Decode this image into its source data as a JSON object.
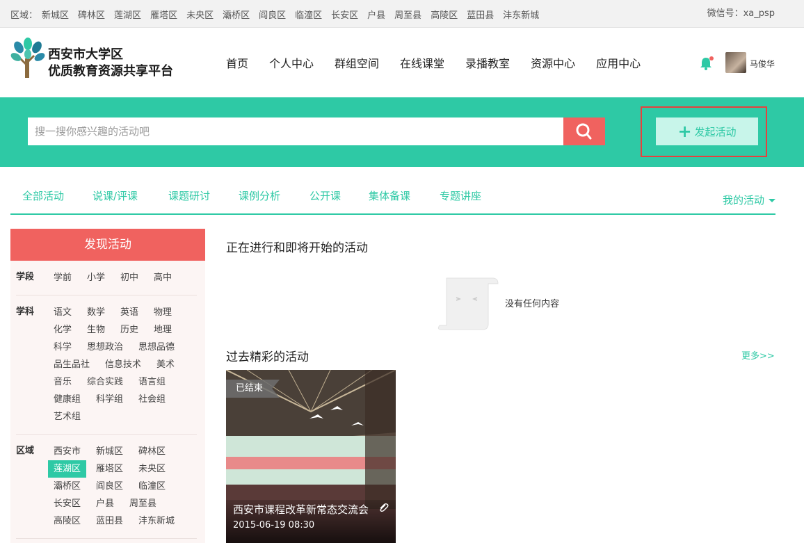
{
  "topbar": {
    "region_label": "区域：",
    "regions": [
      "新城区",
      "碑林区",
      "莲湖区",
      "雁塔区",
      "未央区",
      "灞桥区",
      "阎良区",
      "临潼区",
      "长安区",
      "户县",
      "周至县",
      "高陵区",
      "蓝田县",
      "沣东新城"
    ],
    "wechat": "微信号：xa_psp"
  },
  "logo": {
    "line1": "西安市大学区",
    "line2": "优质教育资源共享平台"
  },
  "nav": [
    "首页",
    "个人中心",
    "群组空间",
    "在线课堂",
    "录播教室",
    "资源中心",
    "应用中心"
  ],
  "user": {
    "name": "马俊华"
  },
  "search": {
    "placeholder": "搜一搜你感兴趣的活动吧",
    "launch_label": "发起活动"
  },
  "tabs": [
    "全部活动",
    "说课/评课",
    "课题研讨",
    "课例分析",
    "公开课",
    "集体备课",
    "专题讲座"
  ],
  "my_activities": "我的活动",
  "sidebar": {
    "title": "发现活动",
    "groups": [
      {
        "label": "学段",
        "items": [
          "学前",
          "小学",
          "初中",
          "高中"
        ]
      },
      {
        "label": "学科",
        "items": [
          "语文",
          "数学",
          "英语",
          "物理",
          "化学",
          "生物",
          "历史",
          "地理",
          "科学",
          "思想政治",
          "思想品德",
          "品生品社",
          "信息技术",
          "美术",
          "音乐",
          "综合实践",
          "语言组",
          "健康组",
          "科学组",
          "社会组",
          "艺术组"
        ]
      },
      {
        "label": "区域",
        "items": [
          "西安市",
          "新城区",
          "碑林区",
          "莲湖区",
          "雁塔区",
          "未央区",
          "灞桥区",
          "阎良区",
          "临潼区",
          "长安区",
          "户县",
          "周至县",
          "高陵区",
          "蓝田县",
          "沣东新城"
        ],
        "selected": "莲湖区"
      }
    ]
  },
  "ongoing": {
    "title": "正在进行和即将开始的活动",
    "empty_text": "没有任何内容"
  },
  "past": {
    "title": "过去精彩的活动",
    "more": "更多>>",
    "cards": [
      {
        "badge": "已结束",
        "title": "西安市课程改革新常态交流会",
        "date": "2015-06-19 08:30"
      }
    ]
  },
  "colors": {
    "teal": "#2ec9a5",
    "coral": "#f0625f"
  }
}
